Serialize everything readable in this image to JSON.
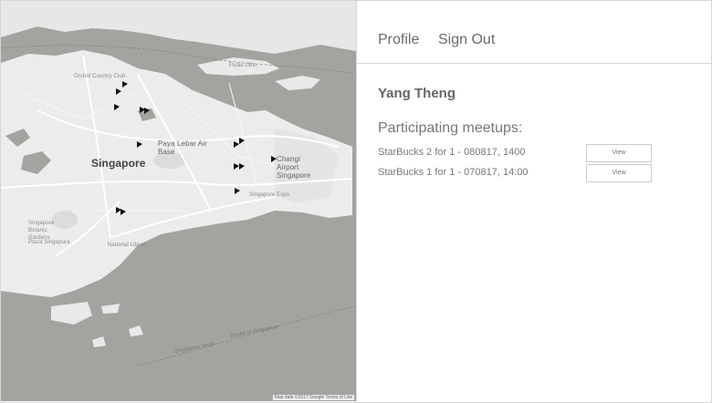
{
  "nav": {
    "profile": "Profile",
    "sign_out": "Sign Out"
  },
  "user": {
    "name": "Yang Theng"
  },
  "meetups": {
    "heading": "Participating meetups:",
    "items": [
      {
        "label": "StarBucks 2 for 1 - 080817, 1400",
        "button": "View"
      },
      {
        "label": "StarBucks 1 for 1 - 070817, 14:00",
        "button": "View"
      }
    ]
  },
  "map": {
    "city_label": "Singapore",
    "labels": [
      "Paya Lebar Air Base",
      "Changi Airport Singapore",
      "Singapore Botanic Gardens",
      "Plaza Singapura",
      "Singapore Expo",
      "National Library",
      "Orchid Country Club",
      "Pulau Ubin",
      "Singapore Strait",
      "Straits of Singapore"
    ],
    "attribution": "Map data ©2017 Google  Terms of Use"
  },
  "colors": {
    "nav_text": "#6a6a6a",
    "border": "#d6d6d6",
    "water": "#a3a39f",
    "land": "#ececec"
  }
}
